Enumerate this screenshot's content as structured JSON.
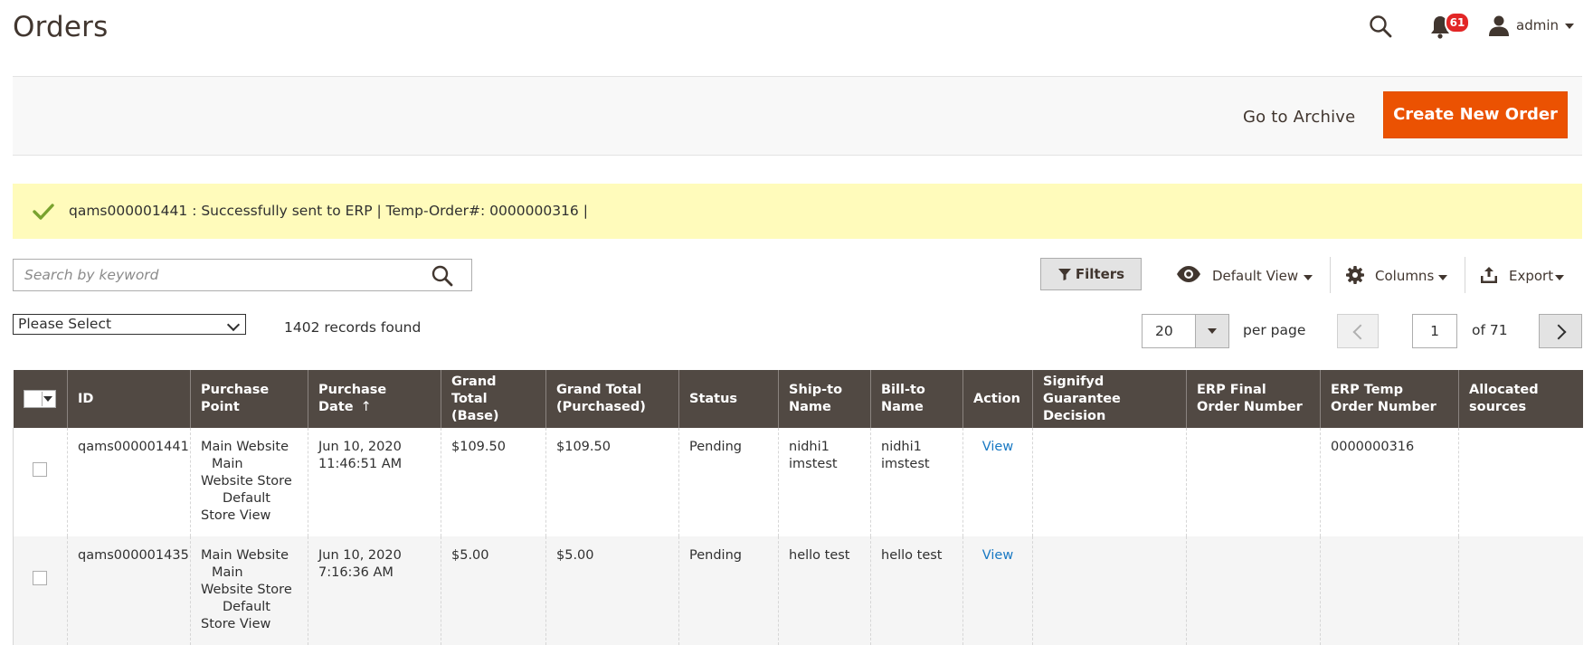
{
  "header": {
    "title": "Orders",
    "notifications_count": "61",
    "user_name": "admin"
  },
  "actions": {
    "archive_label": "Go to Archive",
    "create_label": "Create New Order"
  },
  "message": {
    "text": "qams000001441 : Successfully sent to ERP | Temp-Order#: 0000000316 |"
  },
  "toolbar": {
    "search_placeholder": "Search by keyword",
    "filters_label": "Filters",
    "view_label": "Default View",
    "columns_label": "Columns",
    "export_label": "Export"
  },
  "grid_controls": {
    "mass_action_selected": "Please Select",
    "records_found": "1402 records found",
    "per_page_value": "20",
    "per_page_label": "per page",
    "current_page": "1",
    "total_pages_label": "of 71"
  },
  "table": {
    "headers": {
      "id": "ID",
      "purchase_point": "Purchase Point",
      "purchase_date": "Purchase Date",
      "sort_indicator": "↑",
      "grand_total_base": "Grand Total (Base)",
      "grand_total_purchased": "Grand Total (Purchased)",
      "status": "Status",
      "ship_to": "Ship-to Name",
      "bill_to": "Bill-to Name",
      "action": "Action",
      "signifyd": "Signifyd Guarantee Decision",
      "erp_final": "ERP Final Order Number",
      "erp_temp": "ERP Temp Order Number",
      "allocated": "Allocated sources"
    },
    "rows": [
      {
        "id": "qams000001441",
        "pp_line1": "Main Website",
        "pp_line2": "Main Website Store",
        "pp_line3": "Default Store View",
        "date_line1": "Jun 10, 2020",
        "date_line2": "11:46:51 AM",
        "grand_total_base": "$109.50",
        "grand_total_purchased": "$109.50",
        "status": "Pending",
        "ship_to": "nidhi1 imstest",
        "bill_to": "nidhi1 imstest",
        "action": "View",
        "signifyd": "",
        "erp_final": "",
        "erp_temp": "0000000316",
        "allocated": ""
      },
      {
        "id": "qams000001435",
        "pp_line1": "Main Website",
        "pp_line2": "Main Website Store",
        "pp_line3": "Default Store View",
        "date_line1": "Jun 10, 2020",
        "date_line2": "7:16:36 AM",
        "grand_total_base": "$5.00",
        "grand_total_purchased": "$5.00",
        "status": "Pending",
        "ship_to": "hello test",
        "bill_to": "hello test",
        "action": "View",
        "signifyd": "",
        "erp_final": "",
        "erp_temp": "",
        "allocated": ""
      }
    ]
  },
  "colors": {
    "accent_orange": "#eb5202",
    "table_header_bg": "#514943",
    "message_bg": "#fffbbb",
    "link_blue": "#1979c3",
    "badge_red": "#e22626",
    "success_green": "#79a22e"
  },
  "icons": {
    "search": "search-icon",
    "notifications": "bell-icon",
    "user": "user-icon",
    "success": "check-icon",
    "filters": "funnel-icon",
    "view": "eye-icon",
    "columns": "gear-icon",
    "export": "upload-icon"
  }
}
